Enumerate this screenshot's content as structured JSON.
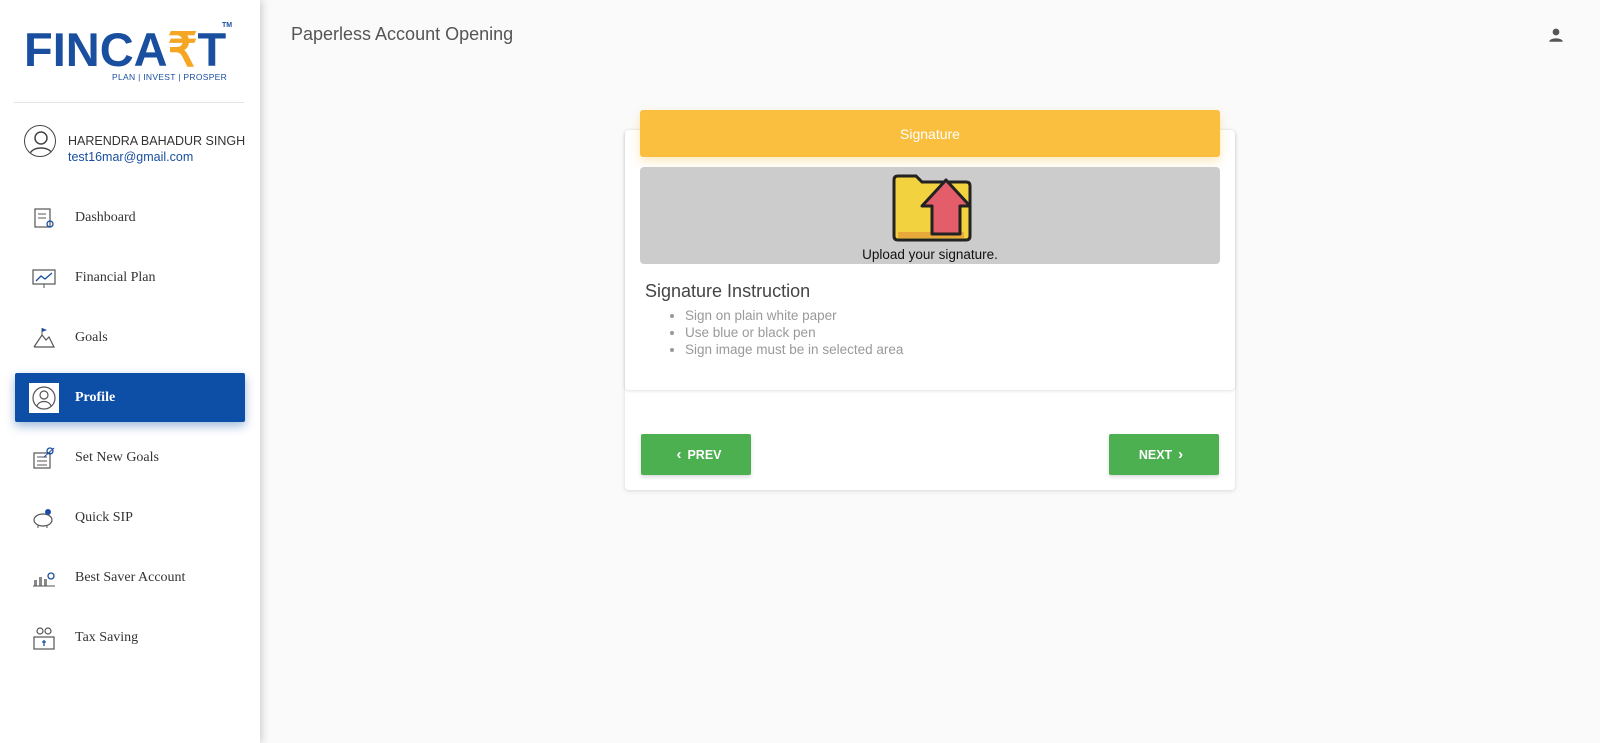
{
  "brand": {
    "logo_text": "FINCART",
    "tm": "TM",
    "tagline": "PLAN | INVEST | PROSPER"
  },
  "user": {
    "name": "HARENDRA BAHADUR SINGH",
    "email": "test16mar@gmail.com"
  },
  "sidebar": {
    "items": [
      {
        "label": "Dashboard",
        "icon": "dashboard-icon"
      },
      {
        "label": "Financial Plan",
        "icon": "chart-board-icon"
      },
      {
        "label": "Goals",
        "icon": "mountain-flag-icon"
      },
      {
        "label": "Profile",
        "icon": "profile-icon",
        "active": true
      },
      {
        "label": "Set New Goals",
        "icon": "target-calendar-icon"
      },
      {
        "label": "Quick SIP",
        "icon": "piggy-bank-icon"
      },
      {
        "label": "Best Saver Account",
        "icon": "savings-icon"
      },
      {
        "label": "Tax Saving",
        "icon": "tax-icon"
      }
    ]
  },
  "header": {
    "title": "Paperless Account Opening",
    "account_icon": "account-icon"
  },
  "card": {
    "header": "Signature",
    "upload_text": "Upload your signature.",
    "upload_icon": "folder-upload-icon",
    "instruction_title": "Signature Instruction",
    "instructions": [
      "Sign on plain white paper",
      "Use blue or black pen",
      "Sign image must be in selected area"
    ],
    "prev_label": "PREV",
    "next_label": "NEXT"
  },
  "colors": {
    "brand_blue": "#1a4fa0",
    "active_nav": "#0d4ea6",
    "header_yellow": "#fbbf40",
    "button_green": "#4caf50",
    "upload_gray": "#cccccc"
  }
}
